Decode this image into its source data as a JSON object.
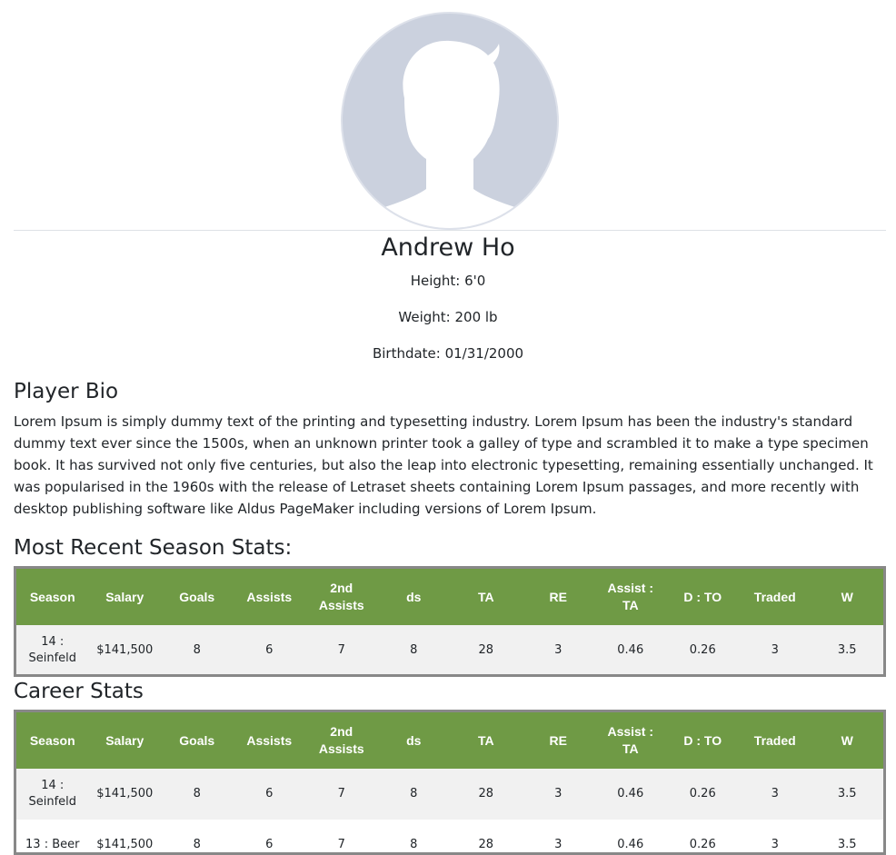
{
  "player": {
    "name": "Andrew Ho",
    "height": "Height: 6'0",
    "weight": "Weight: 200 lb",
    "birthdate": "Birthdate: 01/31/2000"
  },
  "bio": {
    "title": "Player Bio",
    "text": "Lorem Ipsum is simply dummy text of the printing and typesetting industry. Lorem Ipsum has been the industry's standard dummy text ever since the 1500s, when an unknown printer took a galley of type and scrambled it to make a type specimen book. It has survived not only five centuries, but also the leap into electronic typesetting, remaining essentially unchanged. It was popularised in the 1960s with the release of Letraset sheets containing Lorem Ipsum passages, and more recently with desktop publishing software like Aldus PageMaker including versions of Lorem Ipsum."
  },
  "recent": {
    "title": "Most Recent Season Stats:",
    "headers": [
      "Season",
      "Salary",
      "Goals",
      "Assists",
      "2nd Assists",
      "ds",
      "TA",
      "RE",
      "Assist : TA",
      "D : TO",
      "Traded",
      "W"
    ],
    "rows": [
      [
        "14 : Seinfeld",
        "$141,500",
        "8",
        "6",
        "7",
        "8",
        "28",
        "3",
        "0.46",
        "0.26",
        "3",
        "3.5"
      ]
    ]
  },
  "career": {
    "title": "Career Stats",
    "headers": [
      "Season",
      "Salary",
      "Goals",
      "Assists",
      "2nd Assists",
      "ds",
      "TA",
      "RE",
      "Assist : TA",
      "D : TO",
      "Traded",
      "W"
    ],
    "rows": [
      [
        "14 : Seinfeld",
        "$141,500",
        "8",
        "6",
        "7",
        "8",
        "28",
        "3",
        "0.46",
        "0.26",
        "3",
        "3.5"
      ],
      [
        "13 : Beer",
        "$141,500",
        "8",
        "6",
        "7",
        "8",
        "28",
        "3",
        "0.46",
        "0.26",
        "3",
        "3.5"
      ]
    ]
  },
  "colors": {
    "header_bg": "#6f9a45",
    "avatar_bg": "#cbd1de"
  },
  "icons": {
    "avatar": "person-silhouette-icon"
  }
}
